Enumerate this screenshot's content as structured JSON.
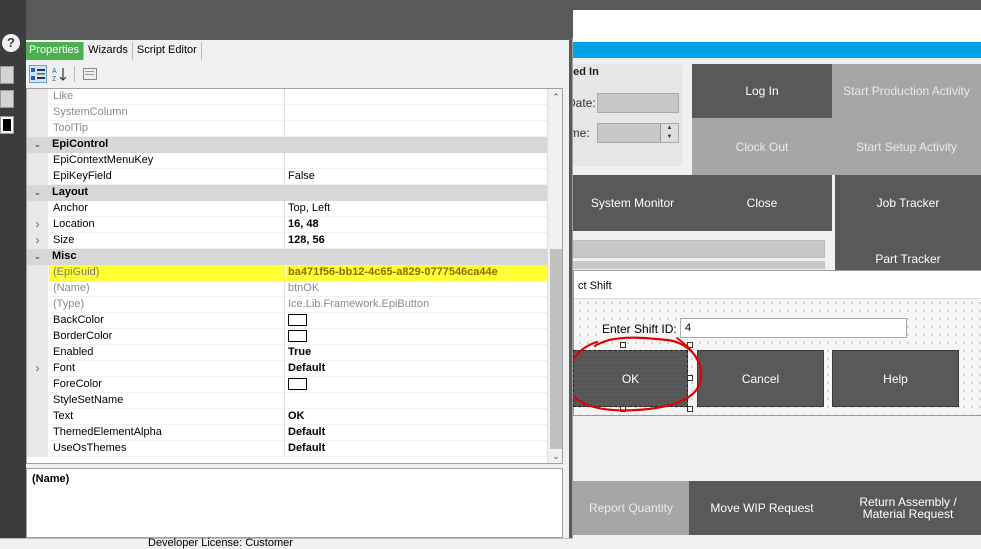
{
  "background_app": {
    "login_title": "ked In",
    "date_label": "Date:",
    "time_label": "ime:",
    "tiles": {
      "log_in": "Log In",
      "start_production": "Start Production Activity",
      "clock_out": "Clock Out",
      "start_setup": "Start Setup Activity",
      "system_monitor": "System Monitor",
      "close": "Close",
      "job_tracker": "Job Tracker",
      "part_tracker": "Part Tracker",
      "report_quantity": "Report Quantity",
      "move_wip": "Move WIP Request",
      "return_assembly": "Return Assembly / Material Request"
    }
  },
  "shift_dialog": {
    "title": "ct Shift",
    "shift_label": "Enter Shift ID:",
    "shift_value": "4",
    "ok_label": "OK",
    "cancel_label": "Cancel",
    "help_label": "Help"
  },
  "help_icon_glyph": "?",
  "properties_panel": {
    "tabs": [
      "Properties",
      "Wizards",
      "Script Editor"
    ],
    "rows": [
      {
        "type": "prop",
        "name": "Like",
        "value": "",
        "style": "gray"
      },
      {
        "type": "prop",
        "name": "SystemColumn",
        "value": "",
        "style": "gray"
      },
      {
        "type": "prop",
        "name": "ToolTip",
        "value": "",
        "style": "gray"
      },
      {
        "type": "cat",
        "name": "EpiControl"
      },
      {
        "type": "prop",
        "name": "EpiContextMenuKey",
        "value": ""
      },
      {
        "type": "prop",
        "name": "EpiKeyField",
        "value": "False"
      },
      {
        "type": "cat",
        "name": "Layout"
      },
      {
        "type": "prop",
        "name": "Anchor",
        "value": "Top, Left"
      },
      {
        "type": "prop",
        "name": "Location",
        "value": "16, 48",
        "style": "bold",
        "expandable": true
      },
      {
        "type": "prop",
        "name": "Size",
        "value": "128, 56",
        "style": "bold",
        "expandable": true
      },
      {
        "type": "cat",
        "name": "Misc"
      },
      {
        "type": "prop",
        "name": "(EpiGuid)",
        "value": "ba471f56-bb12-4c65-a829-0777546ca44e",
        "style": "sel"
      },
      {
        "type": "prop",
        "name": "(Name)",
        "value": "btnOK",
        "style": "gray"
      },
      {
        "type": "prop",
        "name": "(Type)",
        "value": "Ice.Lib.Framework.EpiButton",
        "style": "gray"
      },
      {
        "type": "prop",
        "name": "BackColor",
        "value": "",
        "swatch": true
      },
      {
        "type": "prop",
        "name": "BorderColor",
        "value": "",
        "swatch": true
      },
      {
        "type": "prop",
        "name": "Enabled",
        "value": "True",
        "style": "bold"
      },
      {
        "type": "prop",
        "name": "Font",
        "value": "Default",
        "style": "bold",
        "expandable": true
      },
      {
        "type": "prop",
        "name": "ForeColor",
        "value": "",
        "swatch": true
      },
      {
        "type": "prop",
        "name": "StyleSetName",
        "value": ""
      },
      {
        "type": "prop",
        "name": "Text",
        "value": "OK",
        "style": "bold"
      },
      {
        "type": "prop",
        "name": "ThemedElementAlpha",
        "value": "Default",
        "style": "bold"
      },
      {
        "type": "prop",
        "name": "UseOsThemes",
        "value": "Default",
        "style": "bold"
      }
    ],
    "description_title": "(Name)",
    "status_text": "Developer License:  Customer"
  },
  "colors": {
    "active_tab": "#4caf50",
    "highlight": "#ffff33",
    "accent_blue": "#00a2e8",
    "tile_dark": "#595959",
    "tile_light": "#a6a6a6",
    "annotation_red": "#e00000"
  }
}
